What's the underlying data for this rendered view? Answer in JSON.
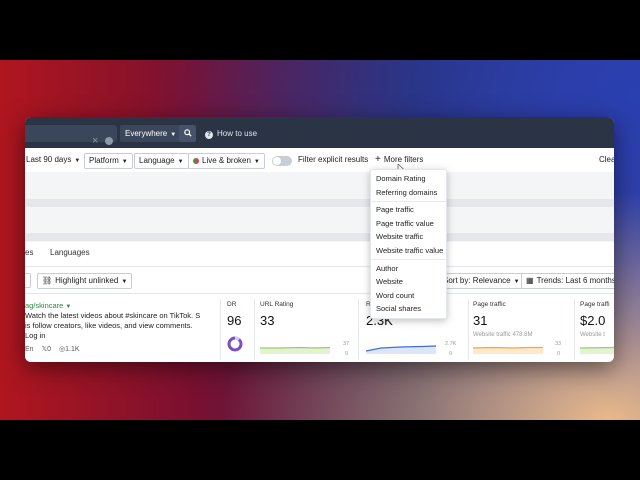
{
  "topbar": {
    "clear_icon": "×",
    "scope_label": "Everywhere",
    "search_icon": "search-icon",
    "how_to_use": "How to use"
  },
  "filters": {
    "last_days": "Last 90 days",
    "platform": "Platform",
    "language": "Language",
    "live_broken": "Live & broken",
    "filter_explicit": "Filter explicit results",
    "more_filters": "More filters",
    "more_filters_prefix": "+",
    "clear_partial": "Clea"
  },
  "tabs": [
    "es",
    "Languages"
  ],
  "toolbar": {
    "highlight_unlinked": "Highlight unlinked",
    "sort_by": "Sort by: Relevance",
    "trends": "Trends: Last 6 months"
  },
  "result": {
    "url": "ag/skincare",
    "text": "Watch the latest videos about #skincare on TikTok. S is follow creators, like videos, and view comments. Log in",
    "meta_lang": "En",
    "meta_x": "0",
    "meta_shares": "1.1K"
  },
  "metrics": {
    "dr_label": "DR",
    "dr_value": "96",
    "url_rating_label": "URL Rating",
    "url_rating_value": "33",
    "url_rating_ticks": [
      "37",
      "0"
    ],
    "ref_label": "R",
    "ref_value": "2.3K",
    "ref_ticks": [
      "2.7K",
      "0"
    ],
    "page_traffic_label": "Page traffic",
    "page_traffic_value": "31",
    "page_traffic_sub": "Website traffic 478.8M",
    "page_traffic_ticks": [
      "33",
      "0"
    ],
    "page_traffic2_label": "Page traffi",
    "page_traffic2_value": "$2.0",
    "page_traffic2_sub": "Website t"
  },
  "more_filters_menu": {
    "group1": [
      "Domain Rating",
      "Referring domains"
    ],
    "group2": [
      "Page traffic",
      "Page traffic value",
      "Website traffic",
      "Website traffic value"
    ],
    "group3": [
      "Author",
      "Website",
      "Word count",
      "Social shares"
    ]
  },
  "colors": {
    "topbar": "#2a3445",
    "url_green": "#2e8b3e",
    "sparkline_green": "#9ccc65",
    "sparkline_blue": "#3f6fd8",
    "sparkline_orange": "#f4a83a",
    "dr_ring": "#7b4fc4"
  }
}
